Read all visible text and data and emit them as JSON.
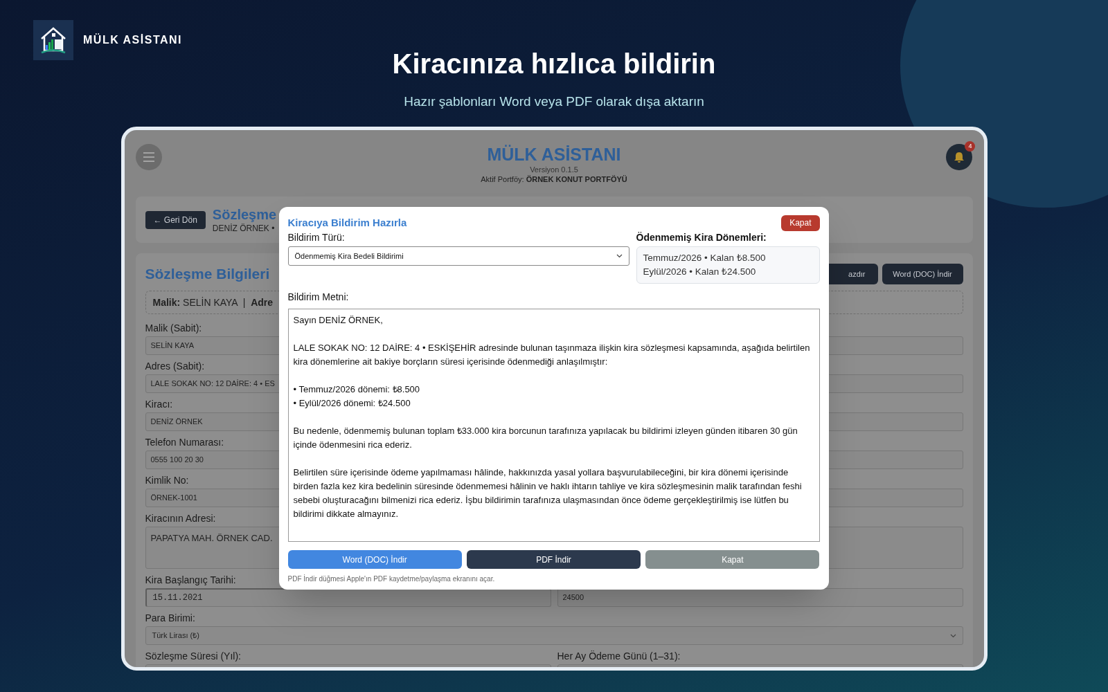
{
  "brand": {
    "name": "MÜLK ASİSTANI"
  },
  "hero": {
    "title": "Kiracınıza hızlıca bildirin",
    "subtitle": "Hazır şablonları Word veya PDF olarak dışa aktarın"
  },
  "app": {
    "title": "MÜLK ASİSTANI",
    "version": "Versiyon 0.1.5",
    "portfolio_label": "Aktif Portföy:",
    "portfolio": "ÖRNEK KONUT PORTFÖYÜ",
    "notification_count": "4",
    "contract_header": {
      "back_button": "← Geri Dön",
      "title": "Sözleşme",
      "subtitle": "DENİZ ÖRNEK •"
    },
    "contract_card": {
      "title": "Sözleşme Bilgileri",
      "actions": [
        "azdır",
        "Word (DOC) İndir"
      ],
      "summary": "**Malik:** SELİN KAYA  |  **Adre**",
      "rows": [
        [
          {
            "label": "Malik (Sabit):",
            "value": "SELİN KAYA",
            "kind": "input"
          }
        ],
        [
          {
            "label": "Adres (Sabit):",
            "value": "LALE SOKAK NO: 12 DAİRE: 4 • ES",
            "kind": "input"
          }
        ],
        [
          {
            "label": "Kiracı:",
            "value": "DENİZ ÖRNEK",
            "kind": "input"
          }
        ],
        [
          {
            "label": "Telefon Numarası:",
            "value": "0555 100 20 30",
            "kind": "input"
          }
        ],
        [
          {
            "label": "Kimlik No:",
            "value": "ÖRNEK-1001",
            "kind": "input"
          }
        ],
        [
          {
            "label": "Kiracının Adresi:",
            "value": "PAPATYA MAH. ÖRNEK CAD.",
            "kind": "textarea"
          }
        ],
        [
          {
            "label": "Kira Başlangıç Tarihi:",
            "value": "15.11.2021",
            "kind": "date"
          },
          {
            "value": "24500",
            "kind": "input"
          }
        ],
        [
          {
            "label": "Para Birimi:",
            "value": "Türk Lirası (₺)",
            "kind": "select"
          }
        ],
        [
          {
            "label": "Sözleşme Süresi (Yıl):",
            "kind": "input"
          },
          {
            "label": "Her Ay Ödeme Günü (1–31):",
            "kind": "input"
          }
        ]
      ]
    }
  },
  "modal": {
    "title": "Kiracıya Bildirim Hazırla",
    "close_button": "Kapat",
    "type_label": "Bildirim Türü:",
    "type_value": "Ödenmemiş Kira Bedeli Bildirimi",
    "periods_label": "Ödenmemiş Kira Dönemleri:",
    "periods": [
      "Temmuz/2026 • Kalan ₺8.500",
      "Eylül/2026 • Kalan ₺24.500"
    ],
    "text_label": "Bildirim Metni:",
    "text": "Sayın DENİZ ÖRNEK,\n\nLALE SOKAK NO: 12 DAİRE: 4 • ESKİŞEHİR adresinde bulunan taşınmaza ilişkin kira sözleşmesi kapsamında, aşağıda belirtilen kira dönemlerine ait bakiye borçların süresi içerisinde ödenmediği anlaşılmıştır:\n\n• Temmuz/2026 dönemi: ₺8.500\n• Eylül/2026 dönemi: ₺24.500\n\nBu nedenle, ödenmemiş bulunan toplam ₺33.000 kira borcunun tarafınıza yapılacak bu bildirimi izleyen günden itibaren 30 gün içinde ödenmesini rica ederiz.\n\nBelirtilen süre içerisinde ödeme yapılmaması hâlinde, hakkınızda yasal yollara başvurulabileceğini, bir kira dönemi içerisinde birden fazla kez kira bedelinin süresinde ödenmemesi hâlinin ve haklı ihtarın tahliye ve kira sözleşmesinin malik tarafından feshi sebebi oluşturacağını bilmenizi rica ederiz. İşbu bildirimin tarafınıza ulaşmasından önce ödeme gerçekleştirilmiş ise lütfen bu bildirimi dikkate almayınız.",
    "buttons": [
      {
        "label": "Word (DOC) İndir",
        "kind": "primary"
      },
      {
        "label": "PDF İndir",
        "kind": "dark"
      },
      {
        "label": "Kapat",
        "kind": "secondary"
      }
    ],
    "note": "PDF İndir düğmesi Apple'ın PDF kaydetme/paylaşma ekranını açar."
  }
}
